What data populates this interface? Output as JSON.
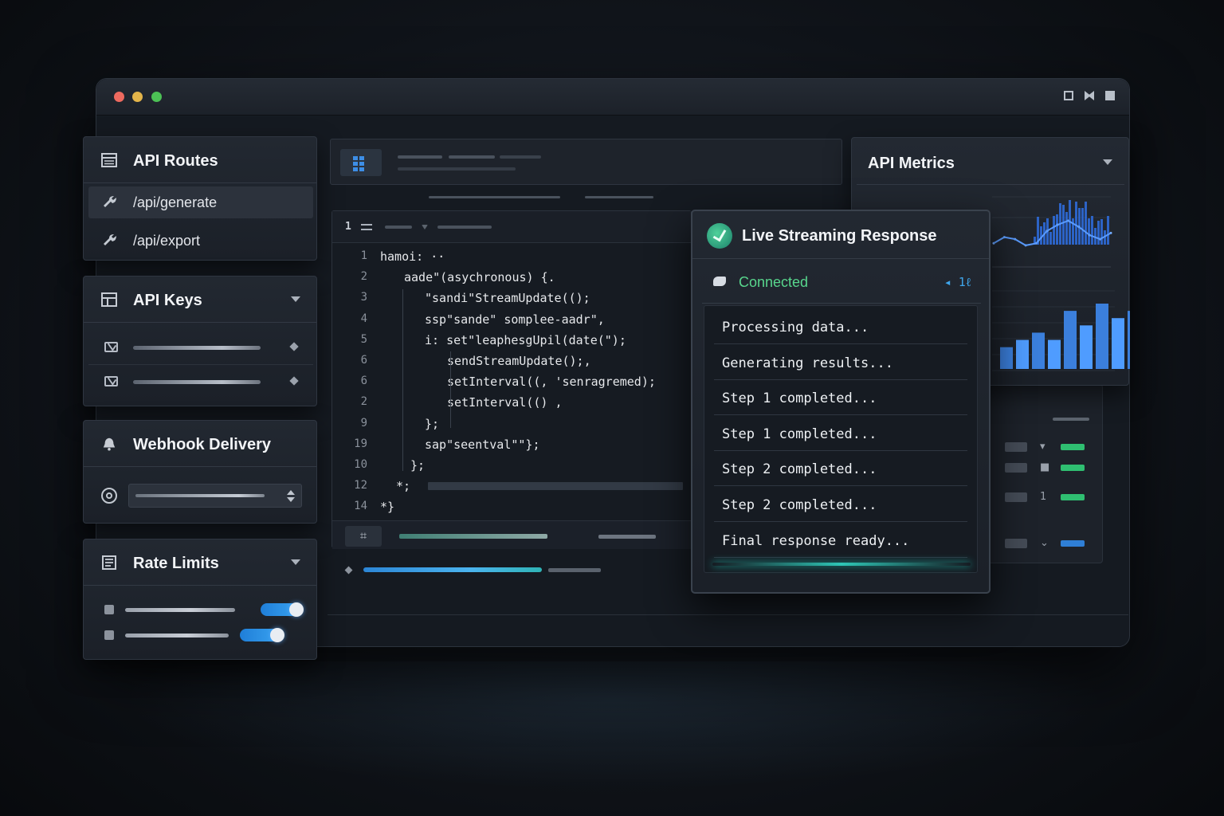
{
  "window": {
    "controls": [
      "close",
      "minimize",
      "maximize"
    ]
  },
  "api_routes": {
    "title": "API Routes",
    "icon": "table-icon",
    "items": [
      {
        "label": "/api/generate",
        "icon": "wrench-icon",
        "active": true
      },
      {
        "label": "/api/export",
        "icon": "wrench-icon",
        "active": false
      }
    ]
  },
  "api_keys": {
    "title": "API Keys",
    "icon": "layout-icon",
    "rows": [
      {
        "icon": "mail-icon"
      },
      {
        "icon": "mail-icon"
      }
    ]
  },
  "webhook": {
    "title": "Webhook Delivery",
    "icon": "bell-icon"
  },
  "rate_limits": {
    "title": "Rate Limits",
    "icon": "list-icon",
    "toggles": [
      {
        "on": true,
        "level": 0.9
      },
      {
        "on": true,
        "level": 0.85
      }
    ]
  },
  "editor": {
    "tab_number": "1",
    "lines": [
      {
        "n": "1",
        "code": "hamoi: ··"
      },
      {
        "n": "2",
        "code": "aade\"(asychronous) {."
      },
      {
        "n": "3",
        "code": "\"sandi\"StreamUpdate(();"
      },
      {
        "n": "4",
        "code": "ssp\"sande\" somplee-aadr\","
      },
      {
        "n": "5",
        "code": "i: set\"leaphesgUpil(date(\");"
      },
      {
        "n": "6",
        "code": "sendStreamUpdate();,"
      },
      {
        "n": "6",
        "code": "setInterval((, 'senragremed);"
      },
      {
        "n": "2",
        "code": "setInterval(() ,"
      },
      {
        "n": "9",
        "code": "};"
      },
      {
        "n": "19",
        "code": "sap\"seentval\"\"};"
      },
      {
        "n": "10",
        "code": "};"
      },
      {
        "n": "12",
        "code": "*;"
      },
      {
        "n": "14",
        "code": "*}"
      }
    ],
    "bottom_button_icon": "hash-icon"
  },
  "metrics": {
    "title": "API Metrics",
    "line_series": [
      3,
      6,
      5,
      2,
      3,
      9,
      12,
      14,
      11,
      7,
      5,
      8
    ],
    "bar_series": [
      3,
      4,
      5,
      4,
      8,
      6,
      9,
      7,
      8
    ]
  },
  "stream": {
    "title": "Live Streaming Response",
    "status": "Connected",
    "status_extra": "◂ 1ℓ",
    "items": [
      "Processing data...",
      "Generating results...",
      "Step 1 completed...",
      "Step 1 completed...",
      "Step 2 completed...",
      "Step 2 completed...",
      "Final response ready..."
    ]
  },
  "side_card": {
    "rows": [
      {
        "marker": "▾",
        "color": "#2fbf71"
      },
      {
        "marker": "■",
        "color": "#2fbf71"
      },
      {
        "marker": "1",
        "color": "#2fbf71"
      },
      {
        "marker": "⌄",
        "color": "#2f7fd6"
      }
    ]
  },
  "colors": {
    "accent_blue": "#2f86de",
    "success_green": "#58d68d",
    "teal": "#2ec6b6"
  }
}
